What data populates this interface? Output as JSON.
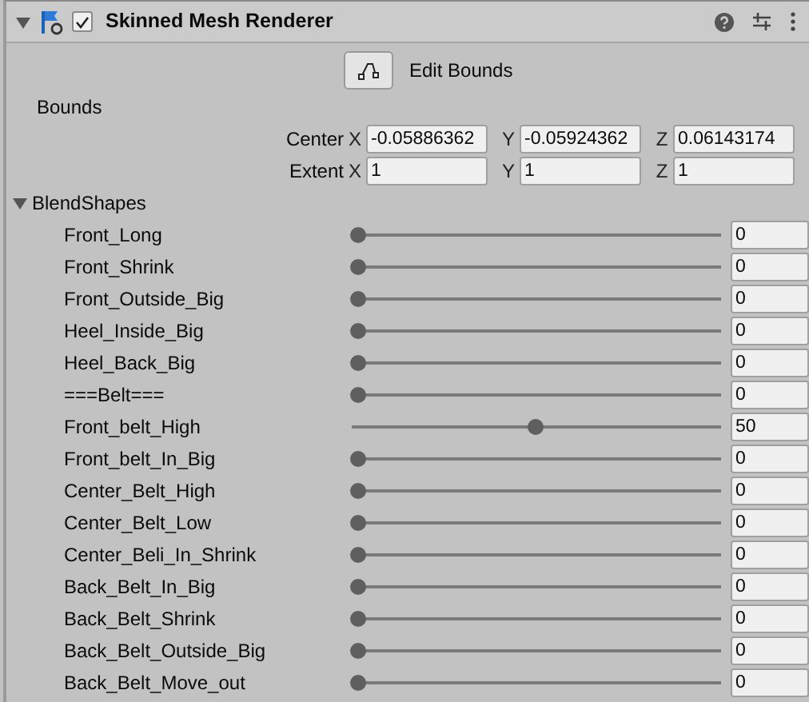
{
  "component": {
    "title": "Skinned Mesh Renderer",
    "expanded": true,
    "enabled": true
  },
  "edit_bounds": {
    "label": "Edit Bounds"
  },
  "bounds": {
    "label": "Bounds",
    "rows": [
      {
        "label": "Center",
        "fields": [
          {
            "axis": "X",
            "value": "-0.05886362"
          },
          {
            "axis": "Y",
            "value": "-0.05924362"
          },
          {
            "axis": "Z",
            "value": "0.06143174"
          }
        ]
      },
      {
        "label": "Extent",
        "fields": [
          {
            "axis": "X",
            "value": "1"
          },
          {
            "axis": "Y",
            "value": "1"
          },
          {
            "axis": "Z",
            "value": "1"
          }
        ]
      }
    ]
  },
  "blend_shapes": {
    "label": "BlendShapes",
    "expanded": true,
    "items": [
      {
        "name": "Front_Long",
        "level": 0,
        "value": "0"
      },
      {
        "name": "Front_Shrink",
        "level": 0,
        "value": "0"
      },
      {
        "name": "Front_Outside_Big",
        "level": 0,
        "value": "0"
      },
      {
        "name": "Heel_Inside_Big",
        "level": 0,
        "value": "0"
      },
      {
        "name": "Heel_Back_Big",
        "level": 0,
        "value": "0"
      },
      {
        "name": "===Belt===",
        "level": 0,
        "value": "0"
      },
      {
        "name": "Front_belt_High",
        "level": 0.5,
        "value": "50"
      },
      {
        "name": "Front_belt_In_Big",
        "level": 0,
        "value": "0"
      },
      {
        "name": "Center_Belt_High",
        "level": 0,
        "value": "0"
      },
      {
        "name": "Center_Belt_Low",
        "level": 0,
        "value": "0"
      },
      {
        "name": "Center_Beli_In_Shrink",
        "level": 0,
        "value": "0"
      },
      {
        "name": "Back_Belt_In_Big",
        "level": 0,
        "value": "0"
      },
      {
        "name": "Back_Belt_Shrink",
        "level": 0,
        "value": "0"
      },
      {
        "name": "Back_Belt_Outside_Big",
        "level": 0,
        "value": "0"
      },
      {
        "name": "Back_Belt_Move_out",
        "level": 0,
        "value": "0"
      }
    ]
  }
}
